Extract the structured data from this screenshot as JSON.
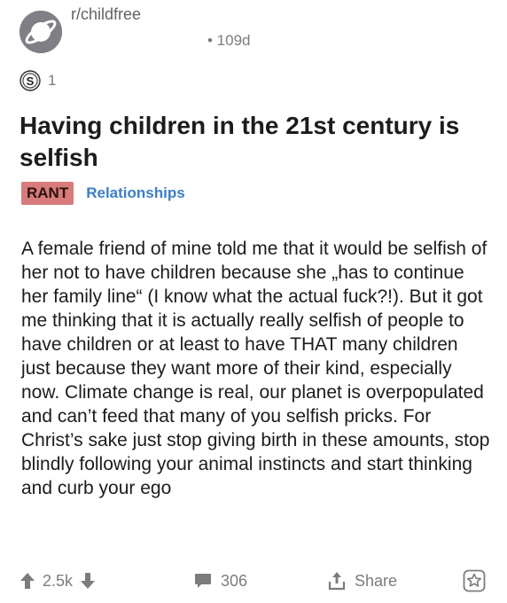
{
  "post": {
    "subreddit": "r/childfree",
    "age": "• 109d",
    "award_count": "1",
    "title": "Having children in the 21st century is selfish",
    "flairs": {
      "rant": "RANT",
      "topic": "Relationships"
    },
    "body": "A female friend of mine told me that it would be selfish of her not to have children because she „has to continue her family line“ (I know what the actual fuck?!). But it got me thinking that it is actually really selfish of people to have children or at least to have THAT many children just because they want more of their kind, especially now. Climate change is real, our planet is overpopulated and can’t feed that many of you selfish pricks. For Christ’s sake just stop giving birth in these amounts, stop blindly following your animal instincts and start thinking and curb your ego"
  },
  "actions": {
    "score": "2.5k",
    "comments": "306",
    "share_label": "Share"
  },
  "colors": {
    "rant_flair_bg": "#d77b7b",
    "topic_flair_text": "#3b7ec6",
    "meta_gray": "#7c7c7c"
  },
  "icons": [
    "subreddit-avatar-icon",
    "silver-award-icon",
    "upvote-icon",
    "downvote-icon",
    "comment-icon",
    "share-icon",
    "save-icon"
  ]
}
